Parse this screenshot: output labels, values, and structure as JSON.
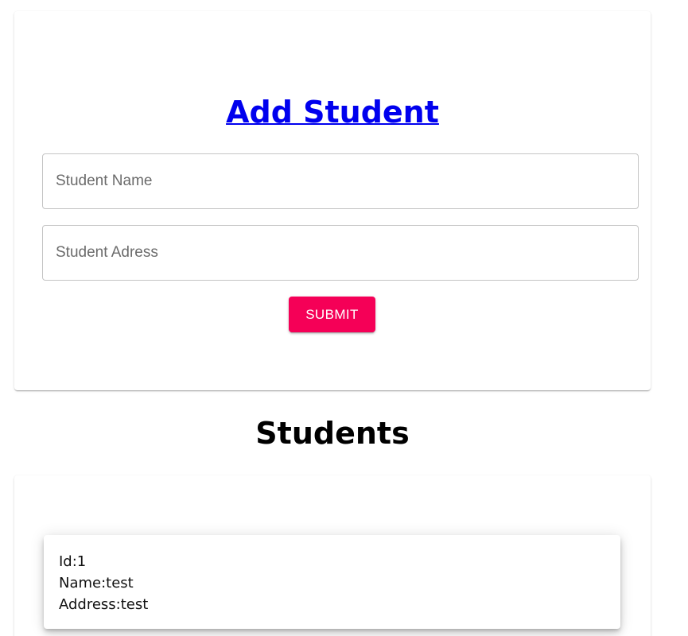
{
  "form": {
    "title": "Add Student",
    "name_field": {
      "placeholder": "Student Name",
      "value": ""
    },
    "address_field": {
      "placeholder": "Student Adress",
      "value": ""
    },
    "submit_label": "SUBMIT"
  },
  "students_section": {
    "title": "Students",
    "items": [
      {
        "id_text": "Id:1",
        "name_text": "Name:test",
        "address_text": "Address:test"
      }
    ]
  },
  "colors": {
    "submit_background": "#f50057",
    "title_link": "#0000ee"
  }
}
